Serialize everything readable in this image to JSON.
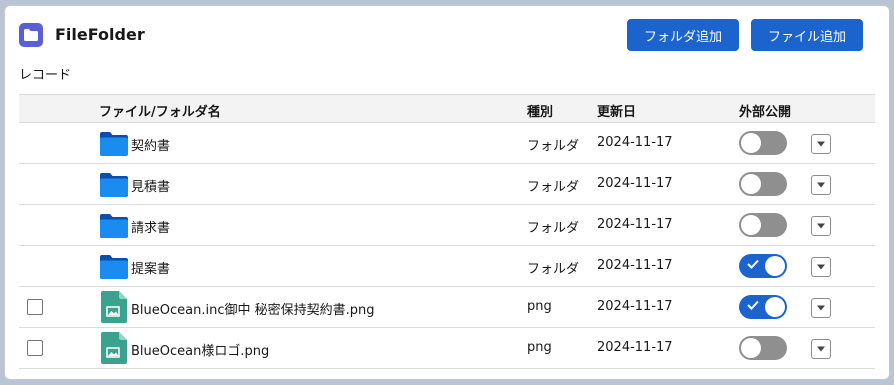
{
  "app": {
    "title": "FileFolder",
    "icon": "folder-icon",
    "icon_color": "#5a5fd6"
  },
  "toolbar": {
    "add_folder_label": "フォルダ追加",
    "add_file_label": "ファイル追加",
    "button_color": "#1b63cd"
  },
  "section": {
    "label": "レコード"
  },
  "table": {
    "headers": {
      "name": "ファイル/フォルダ名",
      "type": "種別",
      "updated": "更新日",
      "public": "外部公開"
    },
    "rows": [
      {
        "kind": "folder",
        "icon": "folder-icon",
        "name": "契約書",
        "type": "フォルダ",
        "date": "2024-11-17",
        "public": false
      },
      {
        "kind": "folder",
        "icon": "folder-icon",
        "name": "見積書",
        "type": "フォルダ",
        "date": "2024-11-17",
        "public": false
      },
      {
        "kind": "folder",
        "icon": "folder-icon",
        "name": "請求書",
        "type": "フォルダ",
        "date": "2024-11-17",
        "public": false
      },
      {
        "kind": "folder",
        "icon": "folder-icon",
        "name": "提案書",
        "type": "フォルダ",
        "date": "2024-11-17",
        "public": true
      },
      {
        "kind": "file",
        "icon": "image-file-icon",
        "name": "BlueOcean.inc御中 秘密保持契約書.png",
        "type": "png",
        "date": "2024-11-17",
        "public": true
      },
      {
        "kind": "file",
        "icon": "image-file-icon",
        "name": "BlueOcean様ロゴ.png",
        "type": "png",
        "date": "2024-11-17",
        "public": false
      }
    ]
  }
}
